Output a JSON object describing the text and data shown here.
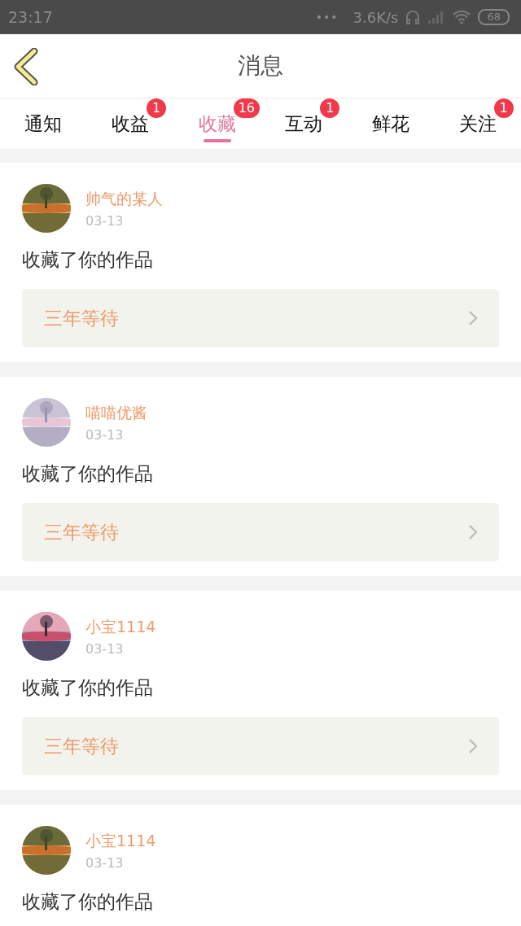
{
  "status_bar": {
    "time": "23:17",
    "dots": "•••",
    "speed": "3.6K/s",
    "battery": "68"
  },
  "header": {
    "title": "消息"
  },
  "tabs": [
    {
      "label": "通知",
      "selected": false
    },
    {
      "label": "收益",
      "selected": false,
      "badge": "1"
    },
    {
      "label": "收藏",
      "selected": true,
      "badge": "16"
    },
    {
      "label": "互动",
      "selected": false,
      "badge": "1"
    },
    {
      "label": "鲜花",
      "selected": false
    },
    {
      "label": "关注",
      "selected": false,
      "badge": "1"
    }
  ],
  "messages": [
    {
      "user": "帅气的某人",
      "date": "03-13",
      "text": "收藏了你的作品",
      "work": "三年等待"
    },
    {
      "user": "喵喵优酱",
      "date": "03-13",
      "text": "收藏了你的作品",
      "work": "三年等待"
    },
    {
      "user": "小宝1114",
      "date": "03-13",
      "text": "收藏了你的作品",
      "work": "三年等待"
    },
    {
      "user": "小宝1114",
      "date": "03-13",
      "text": "收藏了你的作品"
    }
  ]
}
